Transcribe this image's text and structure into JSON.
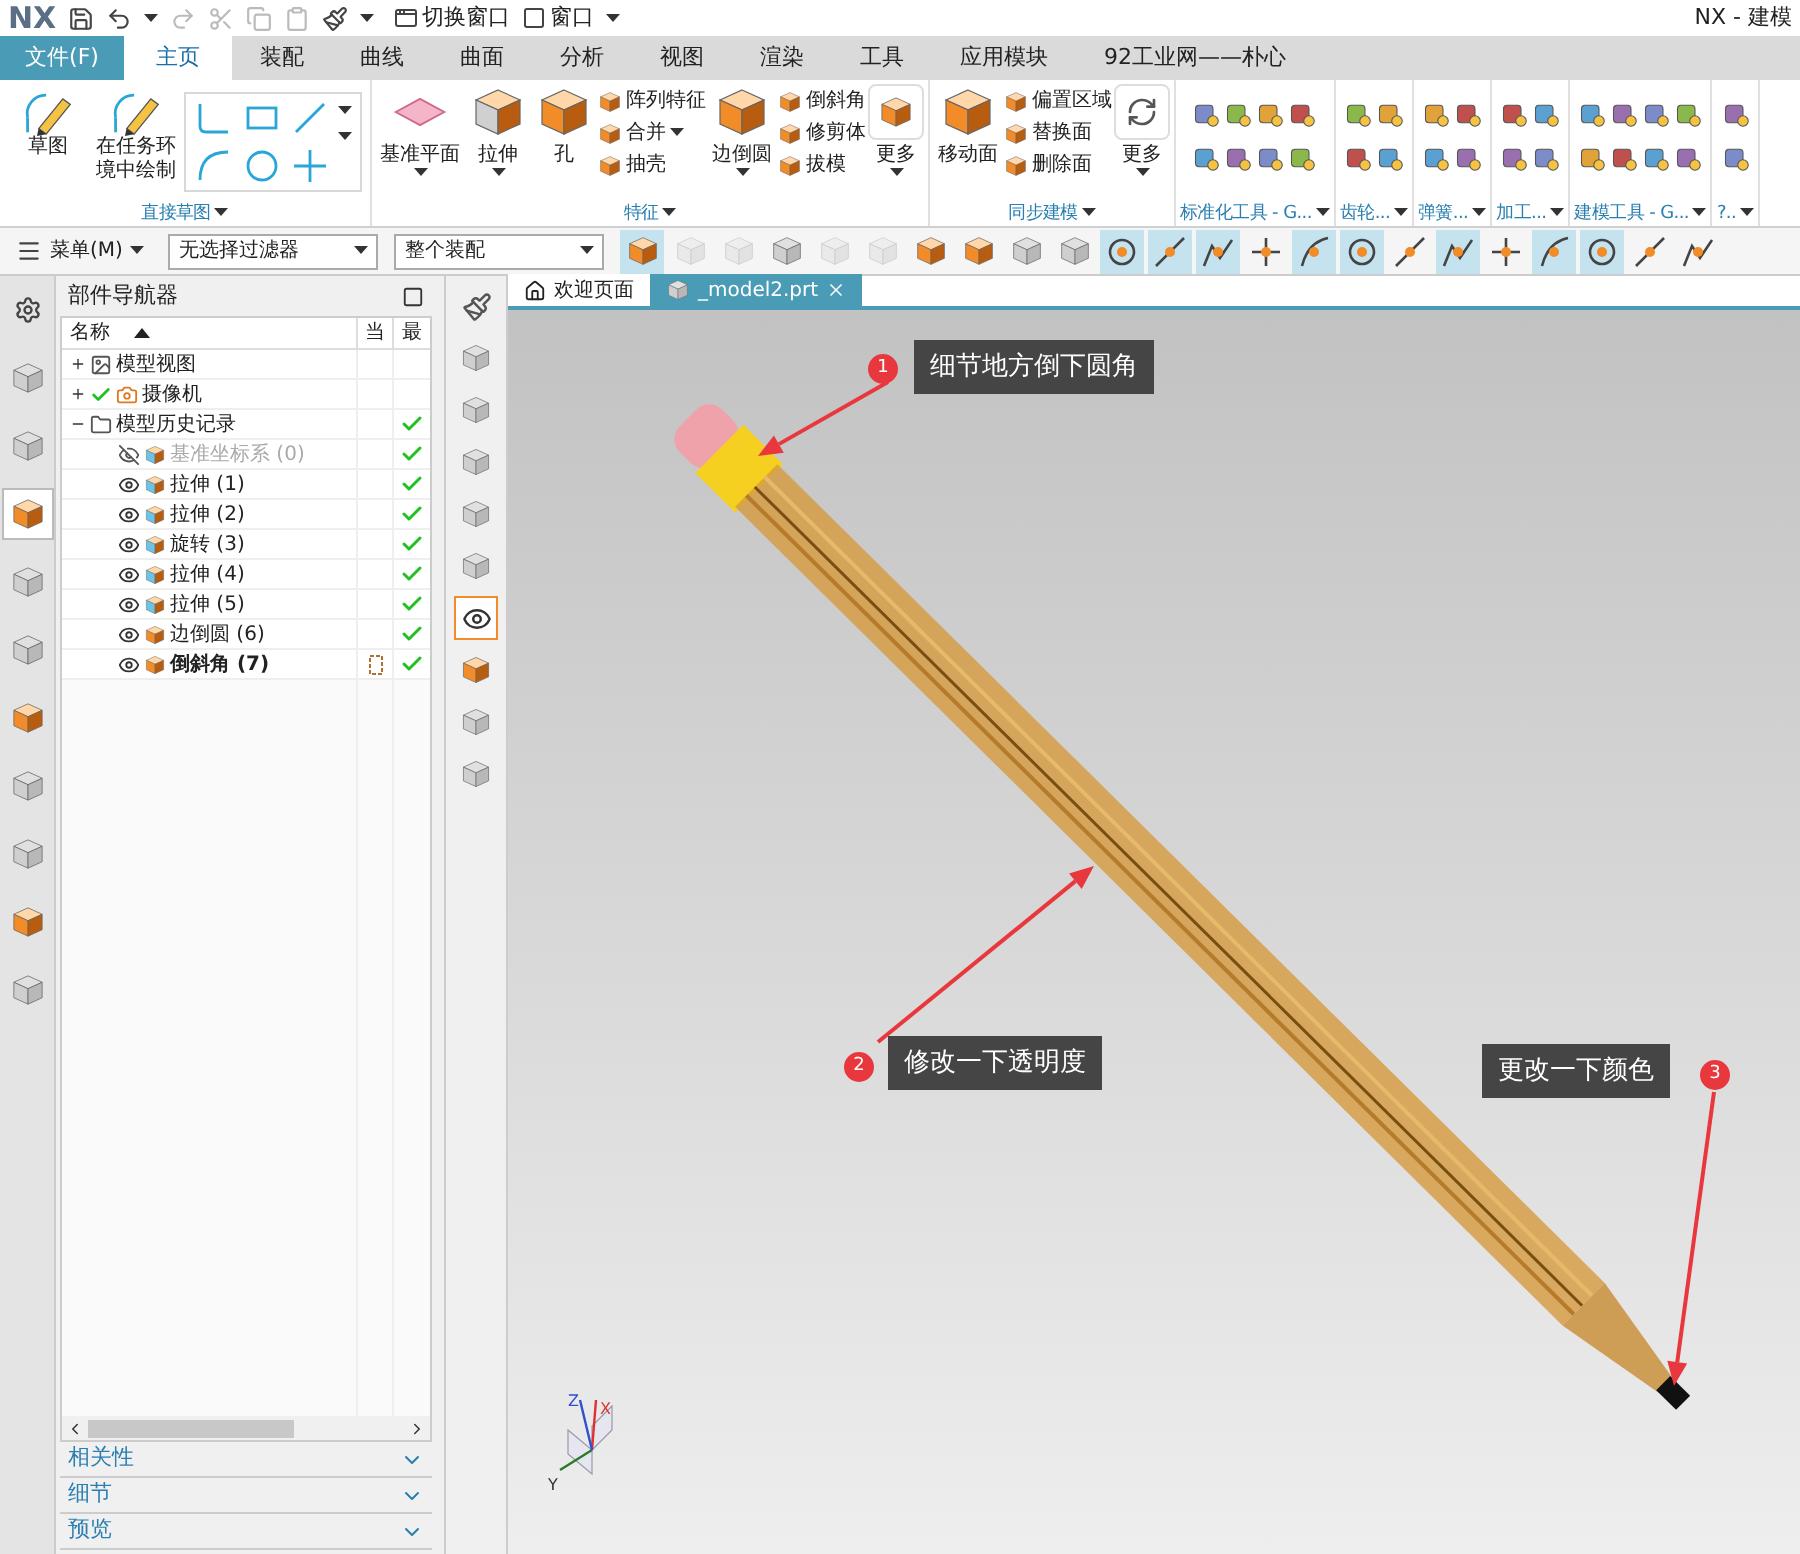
{
  "title_bar": {
    "logo": "NX",
    "switch_window": "切换窗口",
    "window_menu": "窗口",
    "app_title": "NX - 建模"
  },
  "tabs": [
    {
      "label": "文件(F)",
      "kind": "file",
      "selected": false
    },
    {
      "label": "主页",
      "kind": "tab",
      "selected": true
    },
    {
      "label": "装配",
      "kind": "tab",
      "selected": false
    },
    {
      "label": "曲线",
      "kind": "tab",
      "selected": false
    },
    {
      "label": "曲面",
      "kind": "tab",
      "selected": false
    },
    {
      "label": "分析",
      "kind": "tab",
      "selected": false
    },
    {
      "label": "视图",
      "kind": "tab",
      "selected": false
    },
    {
      "label": "渲染",
      "kind": "tab",
      "selected": false
    },
    {
      "label": "工具",
      "kind": "tab",
      "selected": false
    },
    {
      "label": "应用模块",
      "kind": "tab",
      "selected": false
    },
    {
      "label": "92工业网——朴心",
      "kind": "tab",
      "selected": false
    }
  ],
  "ribbon": [
    {
      "label": "直接草图",
      "kind": "sketch",
      "items": [
        {
          "kind": "large",
          "label": "草图",
          "dropdown": false
        },
        {
          "kind": "large",
          "label": "在任务环境中绘制",
          "dropdown": false
        }
      ]
    },
    {
      "label": "特征",
      "kind": "features",
      "items": [
        {
          "kind": "large",
          "label": "基准平面",
          "dropdown": true
        },
        {
          "kind": "large",
          "label": "拉伸",
          "dropdown": true
        },
        {
          "kind": "large",
          "label": "孔",
          "dropdown": false
        },
        {
          "kind": "stack",
          "items": [
            {
              "label": "阵列特征",
              "dropdown": false
            },
            {
              "label": "合并",
              "dropdown": true
            },
            {
              "label": "抽壳",
              "dropdown": false
            }
          ]
        },
        {
          "kind": "large",
          "label": "边倒圆",
          "dropdown": true
        },
        {
          "kind": "stack",
          "items": [
            {
              "label": "倒斜角",
              "dropdown": false
            },
            {
              "label": "修剪体",
              "dropdown": false
            },
            {
              "label": "拔模",
              "dropdown": false
            }
          ]
        },
        {
          "kind": "more",
          "label": "更多",
          "dropdown": true
        }
      ]
    },
    {
      "label": "同步建模",
      "kind": "features",
      "items": [
        {
          "kind": "large",
          "label": "移动面",
          "dropdown": false
        },
        {
          "kind": "stack",
          "items": [
            {
              "label": "偏置区域",
              "dropdown": false
            },
            {
              "label": "替换面",
              "dropdown": false
            },
            {
              "label": "删除面",
              "dropdown": false
            }
          ]
        },
        {
          "kind": "more",
          "label": "更多",
          "dropdown": true
        }
      ]
    },
    {
      "label": "标准化工具 - G...",
      "kind": "tools"
    },
    {
      "label": "齿轮...",
      "kind": "tools"
    },
    {
      "label": "弹簧...",
      "kind": "tools"
    },
    {
      "label": "加工...",
      "kind": "tools"
    },
    {
      "label": "建模工具 - G...",
      "kind": "tools"
    },
    {
      "label": "?..",
      "kind": "tools"
    }
  ],
  "toolbar": {
    "menu": "菜单(M)",
    "filter": "无选择过滤器",
    "scope": "整个装配",
    "buttons": [
      {
        "selected": true,
        "disabled": false
      },
      {
        "selected": false,
        "disabled": true
      },
      {
        "selected": false,
        "disabled": true
      },
      {
        "selected": false,
        "disabled": false
      },
      {
        "selected": false,
        "disabled": true
      },
      {
        "selected": false,
        "disabled": true
      },
      {
        "selected": false,
        "disabled": false
      },
      {
        "selected": false,
        "disabled": false
      },
      {
        "selected": false,
        "disabled": false
      },
      {
        "selected": false,
        "disabled": false
      },
      {
        "selected": true,
        "disabled": false
      },
      {
        "selected": true,
        "disabled": false
      },
      {
        "selected": true,
        "disabled": false
      },
      {
        "selected": false,
        "disabled": false
      },
      {
        "selected": true,
        "disabled": false
      },
      {
        "selected": true,
        "disabled": false
      },
      {
        "selected": false,
        "disabled": false
      },
      {
        "selected": true,
        "disabled": false
      },
      {
        "selected": false,
        "disabled": false
      },
      {
        "selected": true,
        "disabled": false
      },
      {
        "selected": true,
        "disabled": false
      },
      {
        "selected": false,
        "disabled": false
      },
      {
        "selected": false,
        "disabled": false
      }
    ]
  },
  "rail": [
    {
      "selected": false
    },
    {
      "selected": false
    },
    {
      "selected": false
    },
    {
      "selected": true
    },
    {
      "selected": false
    },
    {
      "selected": false
    },
    {
      "selected": false
    },
    {
      "selected": false
    },
    {
      "selected": false
    },
    {
      "selected": false
    },
    {
      "selected": false
    }
  ],
  "navigator": {
    "title": "部件导航器",
    "columns": [
      "名称",
      "当",
      "最"
    ],
    "tree": [
      {
        "label": "模型视图",
        "expanded": false,
        "checked": false,
        "up_to_date": false
      },
      {
        "label": "摄像机",
        "expanded": false,
        "checked": true,
        "up_to_date": false
      },
      {
        "label": "模型历史记录",
        "expanded": true,
        "checked": false,
        "up_to_date": true,
        "children": [
          {
            "label": "基准坐标系 (0)",
            "visible": false,
            "current": false,
            "up_to_date": true
          },
          {
            "label": "拉伸 (1)",
            "visible": true,
            "current": false,
            "up_to_date": true
          },
          {
            "label": "拉伸 (2)",
            "visible": true,
            "current": false,
            "up_to_date": true
          },
          {
            "label": "旋转 (3)",
            "visible": true,
            "current": false,
            "up_to_date": true
          },
          {
            "label": "拉伸 (4)",
            "visible": true,
            "current": false,
            "up_to_date": true
          },
          {
            "label": "拉伸 (5)",
            "visible": true,
            "current": false,
            "up_to_date": true
          },
          {
            "label": "边倒圆 (6)",
            "visible": true,
            "current": false,
            "up_to_date": true
          },
          {
            "label": "倒斜角 (7)",
            "visible": true,
            "current": true,
            "up_to_date": true
          }
        ]
      }
    ],
    "sections": [
      {
        "label": "相关性",
        "expanded": false
      },
      {
        "label": "细节",
        "expanded": false
      },
      {
        "label": "预览",
        "expanded": false
      }
    ]
  },
  "resource_bar": [
    {
      "selected": false
    },
    {
      "selected": false
    },
    {
      "selected": false
    },
    {
      "selected": false
    },
    {
      "selected": false
    },
    {
      "selected": false
    },
    {
      "selected": true
    },
    {
      "selected": false
    },
    {
      "selected": false
    },
    {
      "selected": false
    }
  ],
  "viewport": {
    "tabs": [
      {
        "label": "欢迎页面",
        "kind": "home",
        "selected": false
      },
      {
        "label": "_model2.prt",
        "kind": "part",
        "selected": true
      }
    ],
    "callouts": [
      {
        "number": "1",
        "text": "细节地方倒下圆角"
      },
      {
        "number": "2",
        "text": "修改一下透明度"
      },
      {
        "number": "3",
        "text": "更改一下颜色"
      }
    ],
    "triad": {
      "x": "X",
      "y": "Y",
      "z": "Z"
    }
  }
}
